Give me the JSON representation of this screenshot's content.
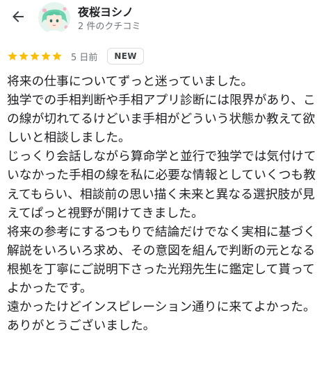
{
  "reviewer": {
    "name": "夜桜ヨシノ",
    "review_count": "2 件のクチコミ"
  },
  "review": {
    "rating": 5,
    "date": "5 日前",
    "badge": "NEW",
    "text": "将来の仕事についてずっと迷っていました。\n独学での手相判断や手相アプリ診断には限界があり、この線が切れてるけどいま手相がどういう状態か教えて欲しいと相談しました。\nじっくり会話しながら算命学と並行で独学では気付けていなかった手相の線を私に必要な情報としていくつも教えてもらい、相談前の思い描く未来と異なる選択肢が見えてぱっと視野が開けてきました。\n将来の参考にするつもりで結論だけでなく実相に基づく解説をいろいろ求め、その意図を組んで判断の元となる根拠を丁寧にご説明下さった光翔先生に鑑定して貰ってよかったです。\n遠かったけどインスピレーション通りに来てよかった。ありがとうございました。"
  },
  "colors": {
    "star": "#fbbc04",
    "secondary_text": "#70757a",
    "primary_text": "#202124"
  },
  "icons": {
    "back": "arrow-back-icon",
    "star": "star-icon"
  }
}
